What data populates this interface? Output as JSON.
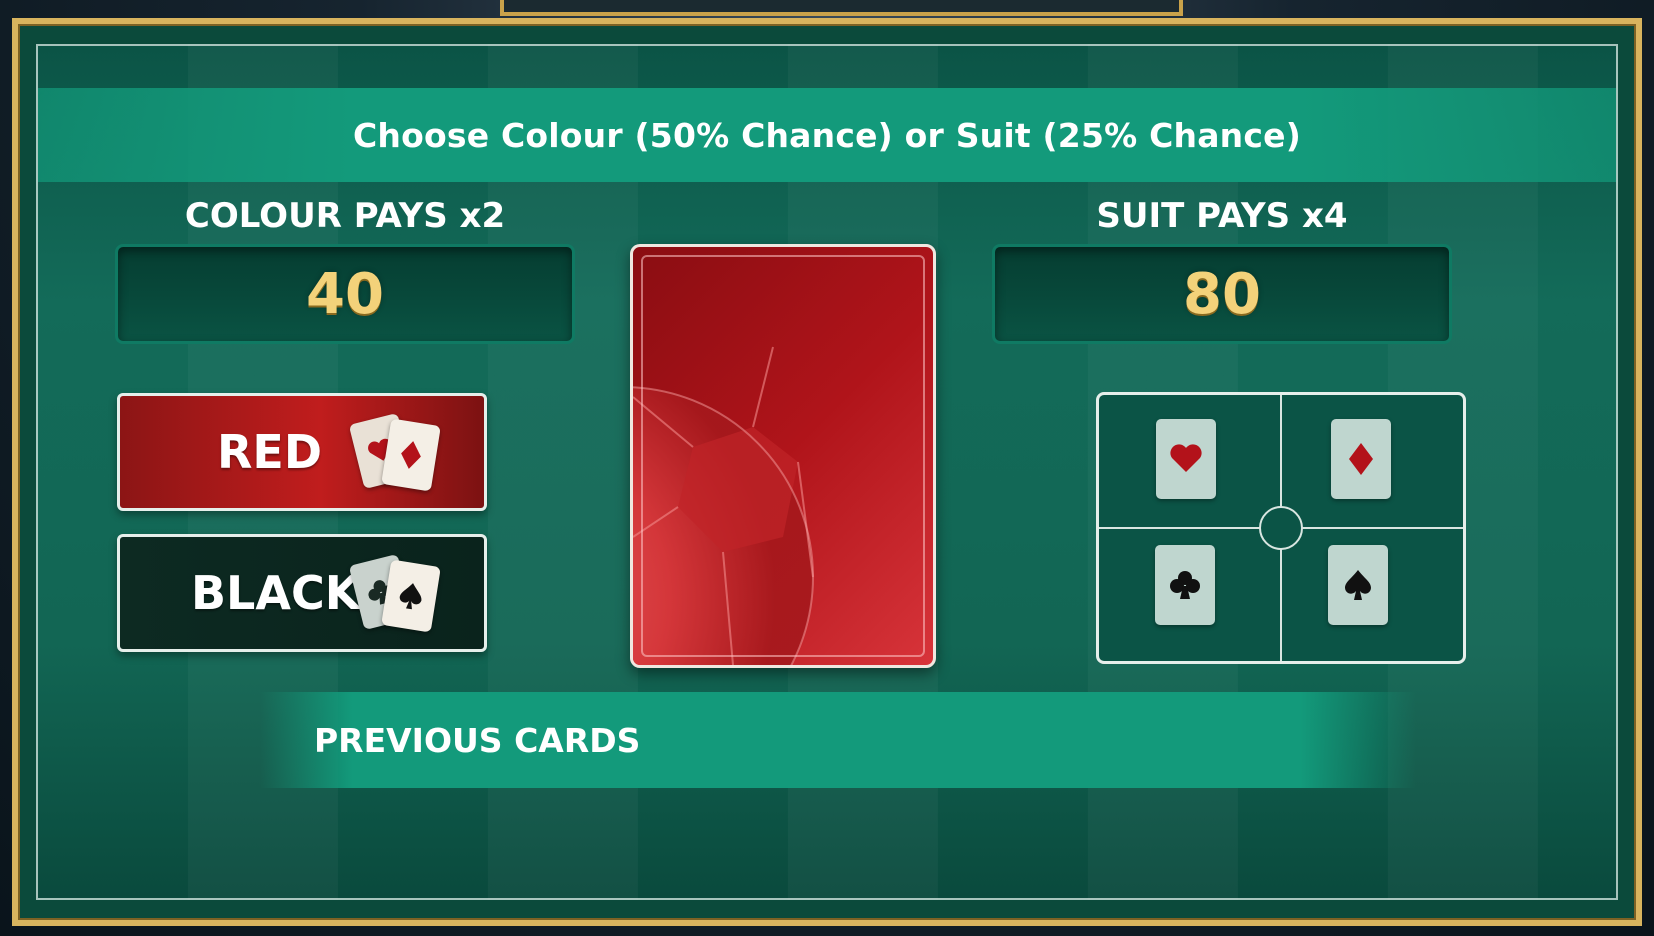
{
  "header": {
    "instruction": "Choose Colour (50% Chance) or Suit (25% Chance)"
  },
  "colour": {
    "label": "COLOUR PAYS x2",
    "value": "40",
    "buttons": [
      {
        "label": "RED",
        "suits": [
          "heart",
          "diamond"
        ]
      },
      {
        "label": "BLACK",
        "suits": [
          "club",
          "spade"
        ]
      }
    ]
  },
  "suit": {
    "label": "SUIT PAYS x4",
    "value": "80",
    "options": [
      "heart",
      "diamond",
      "club",
      "spade"
    ]
  },
  "history": {
    "label": "PREVIOUS CARDS"
  },
  "colors": {
    "gold_value": "#f3d27a",
    "table_green": "#136b59",
    "red_suit": "#b3121a",
    "black_suit": "#111111"
  }
}
